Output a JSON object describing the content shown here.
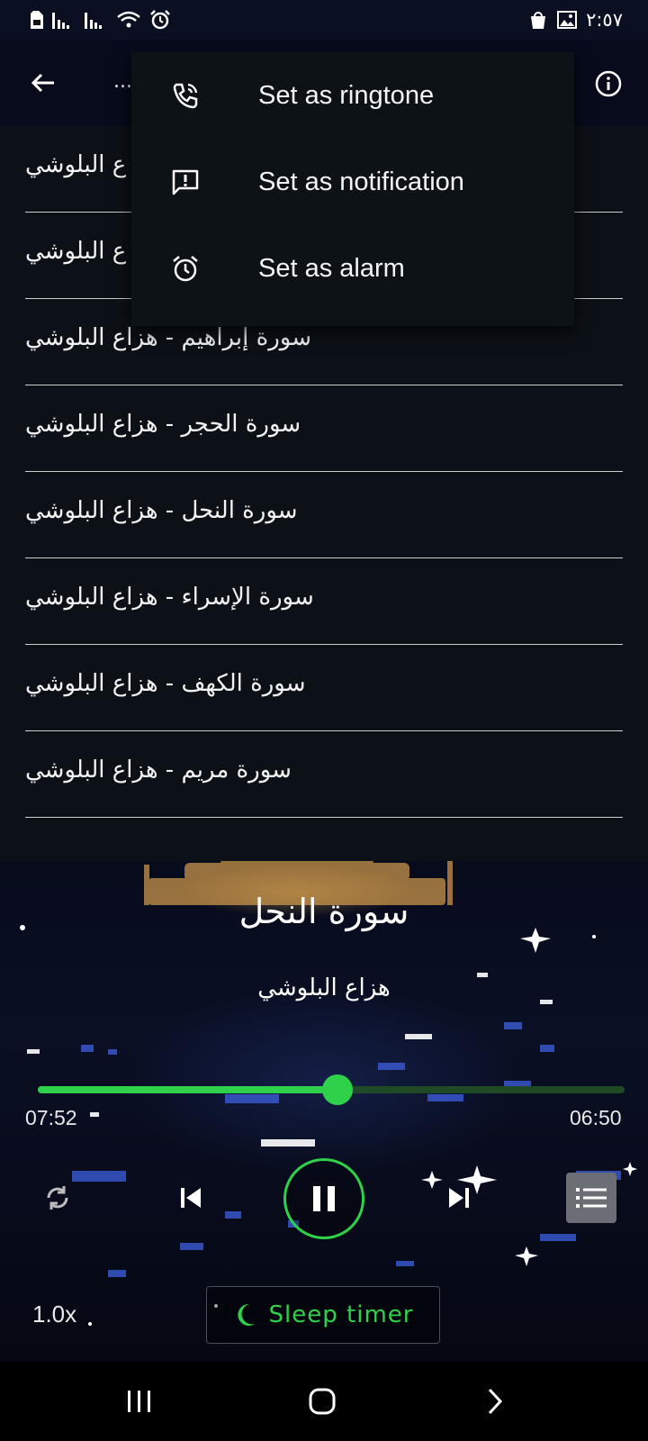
{
  "status_bar": {
    "time": "٢:٥٧"
  },
  "app_bar": {
    "title": "..."
  },
  "playlist": {
    "items": [
      {
        "label": "ع البلوشي"
      },
      {
        "label": "ع البلوشي"
      },
      {
        "label": "سورة إبراهيم - هزاع البلوشي"
      },
      {
        "label": "سورة الحجر - هزاع البلوشي"
      },
      {
        "label": "سورة النحل - هزاع البلوشي"
      },
      {
        "label": "سورة الإسراء - هزاع البلوشي"
      },
      {
        "label": "سورة الكهف - هزاع البلوشي"
      },
      {
        "label": "سورة مريم - هزاع البلوشي"
      }
    ]
  },
  "context_menu": {
    "items": [
      {
        "label": "Set as ringtone",
        "icon": "phone-ringing-icon"
      },
      {
        "label": "Set as notification",
        "icon": "notification-alert-icon"
      },
      {
        "label": "Set as alarm",
        "icon": "alarm-clock-icon"
      }
    ]
  },
  "player": {
    "title": "سورة النحل",
    "artist": "هزاع البلوشي",
    "elapsed": "07:52",
    "total": "06:50",
    "progress_fraction": 0.51,
    "speed": "1.0x",
    "sleep_timer_label": "Sleep timer"
  },
  "colors": {
    "accent": "#2fd04a",
    "panel": "#0c1117",
    "menu": "#0d1217"
  }
}
